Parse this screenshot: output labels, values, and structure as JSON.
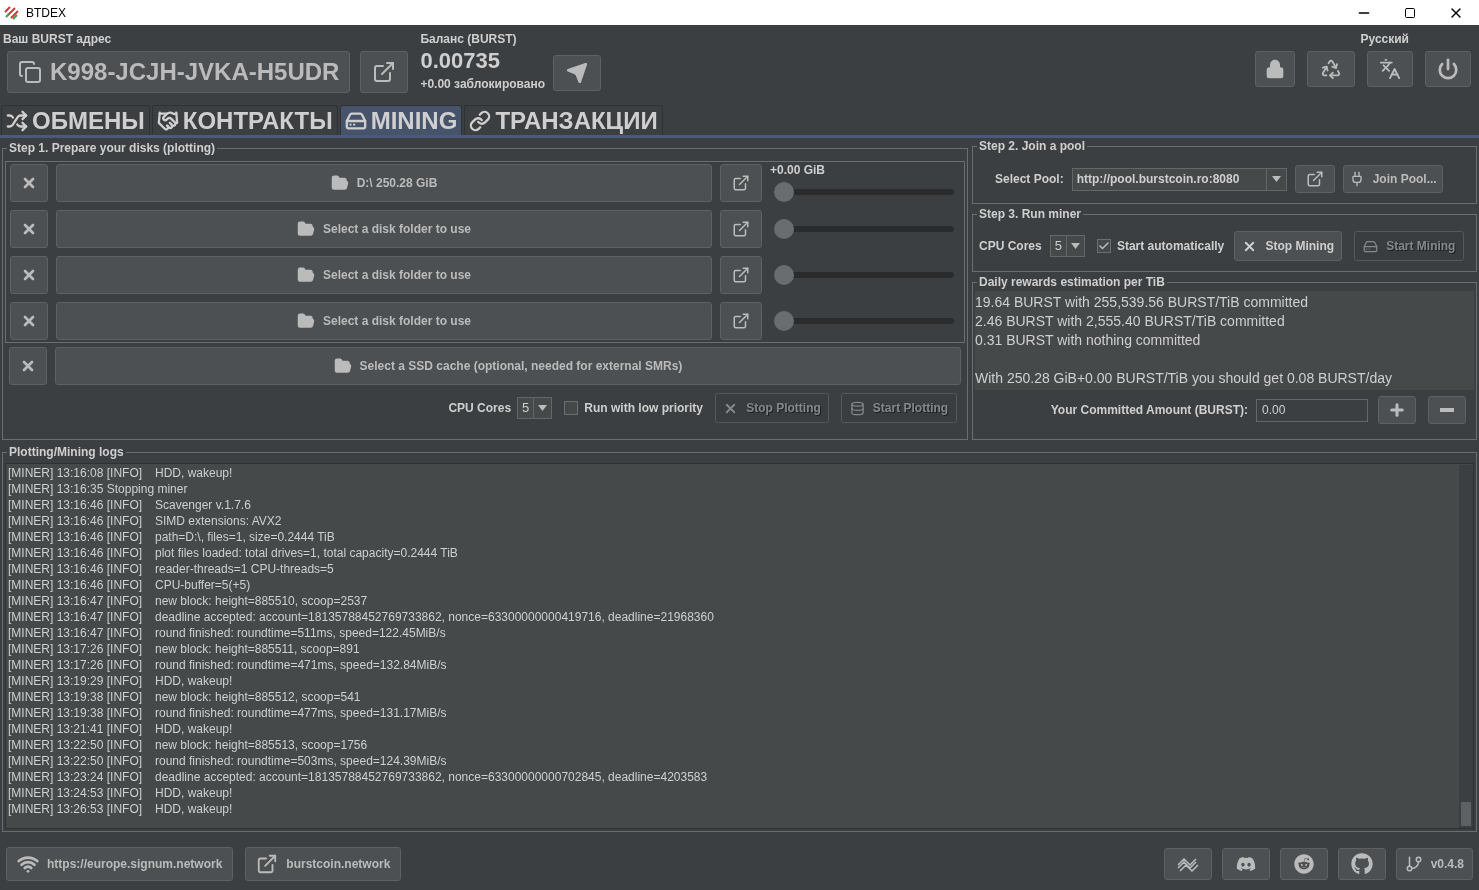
{
  "window": {
    "title": "BTDEX"
  },
  "header": {
    "address_label": "Ваш BURST адрес",
    "address": "K998-JCJH-JVKA-H5UDR",
    "balance_label": "Баланс (BURST)",
    "balance": "0.00735",
    "locked": "+0.00 заблокировано",
    "language": "Русский"
  },
  "tabs": [
    {
      "label": "ОБМЕНЫ",
      "selected": false
    },
    {
      "label": "КОНТРАКТЫ",
      "selected": false
    },
    {
      "label": "MINING",
      "selected": true
    },
    {
      "label": "ТРАНЗАКЦИИ",
      "selected": false
    }
  ],
  "step1": {
    "title": "Step 1. Prepare your disks (plotting)",
    "disks": [
      {
        "label": "D:\\ 250.28 GiB",
        "reading": "+0.00 GiB",
        "level": 0
      },
      {
        "label": "Select a disk folder to use",
        "level": 0
      },
      {
        "label": "Select a disk folder to use",
        "level": 0
      },
      {
        "label": "Select a disk folder to use",
        "level": 0
      }
    ],
    "ssd_cache": "Select a SSD cache (optional, needed for external SMRs)",
    "cpu_label": "CPU Cores",
    "cpu_value": "5",
    "low_priority": {
      "label": "Run with low priority",
      "checked": false
    },
    "buttons": [
      {
        "label": "Stop Plotting",
        "disabled": true
      },
      {
        "label": "Start Plotting",
        "disabled": true
      }
    ]
  },
  "step2": {
    "title": "Step 2. Join a pool",
    "pool_label": "Select Pool:",
    "pool": "http://pool.burstcoin.ro:8080",
    "join": "Join Pool..."
  },
  "step3": {
    "title": "Step 3. Run miner",
    "cpu_label": "CPU Cores",
    "cpu_value": "5",
    "auto_start": {
      "label": "Start automatically",
      "checked": true
    },
    "buttons": [
      {
        "label": "Stop Mining",
        "disabled": false
      },
      {
        "label": "Start Mining",
        "disabled": true
      }
    ]
  },
  "rewards": {
    "title": "Daily rewards estimation per TiB",
    "lines": [
      "19.64 BURST with 255,539.56 BURST/TiB committed",
      "2.46 BURST with 2,555.40 BURST/TiB committed",
      "0.31 BURST with nothing committed",
      "With 250.28 GiB+0.00 BURST/TiB you should get 0.08 BURST/day"
    ],
    "committed_label": "Your Committed Amount (BURST):",
    "committed": "0.00"
  },
  "logs": {
    "title": "Plotting/Mining logs",
    "lines": [
      {
        "kind": "info",
        "head": "[MINER] 13:16:08 [INFO]",
        "text": "HDD, wakeup!"
      },
      {
        "kind": "plain",
        "text": "[MINER] 13:16:35 Stopping miner"
      },
      {
        "kind": "info",
        "head": "[MINER] 13:16:46 [INFO]",
        "text": "Scavenger v.1.7.6"
      },
      {
        "kind": "info",
        "head": "[MINER] 13:16:46 [INFO]",
        "text": "SIMD extensions: AVX2"
      },
      {
        "kind": "info",
        "head": "[MINER] 13:16:46 [INFO]",
        "text": "path=D:\\, files=1, size=0.2444 TiB"
      },
      {
        "kind": "info",
        "head": "[MINER] 13:16:46 [INFO]",
        "text": "plot files loaded: total drives=1, total capacity=0.2444 TiB"
      },
      {
        "kind": "info",
        "head": "[MINER] 13:16:46 [INFO]",
        "text": "reader-threads=1 CPU-threads=5"
      },
      {
        "kind": "info",
        "head": "[MINER] 13:16:46 [INFO]",
        "text": "CPU-buffer=5(+5)"
      },
      {
        "kind": "info",
        "head": "[MINER] 13:16:47 [INFO]",
        "text": "new block: height=885510, scoop=2537"
      },
      {
        "kind": "info",
        "head": "[MINER] 13:16:47 [INFO]",
        "text": "deadline accepted: account=18135788452769733862, nonce=63300000000419716, deadline=21968360"
      },
      {
        "kind": "info",
        "head": "[MINER] 13:16:47 [INFO]",
        "text": "round finished: roundtime=511ms, speed=122.45MiB/s"
      },
      {
        "kind": "info",
        "head": "[MINER] 13:17:26 [INFO]",
        "text": "new block: height=885511, scoop=891"
      },
      {
        "kind": "info",
        "head": "[MINER] 13:17:26 [INFO]",
        "text": "round finished: roundtime=471ms, speed=132.84MiB/s"
      },
      {
        "kind": "info",
        "head": "[MINER] 13:19:29 [INFO]",
        "text": "HDD, wakeup!"
      },
      {
        "kind": "info",
        "head": "[MINER] 13:19:38 [INFO]",
        "text": "new block: height=885512, scoop=541"
      },
      {
        "kind": "info",
        "head": "[MINER] 13:19:38 [INFO]",
        "text": "round finished: roundtime=477ms, speed=131.17MiB/s"
      },
      {
        "kind": "info",
        "head": "[MINER] 13:21:41 [INFO]",
        "text": "HDD, wakeup!"
      },
      {
        "kind": "info",
        "head": "[MINER] 13:22:50 [INFO]",
        "text": "new block: height=885513, scoop=1756"
      },
      {
        "kind": "info",
        "head": "[MINER] 13:22:50 [INFO]",
        "text": "round finished: roundtime=503ms, speed=124.39MiB/s"
      },
      {
        "kind": "info",
        "head": "[MINER] 13:23:24 [INFO]",
        "text": "deadline accepted: account=18135788452769733862, nonce=63300000000702845, deadline=4203583"
      },
      {
        "kind": "info",
        "head": "[MINER] 13:24:53 [INFO]",
        "text": "HDD, wakeup!"
      },
      {
        "kind": "info",
        "head": "[MINER] 13:26:53 [INFO]",
        "text": "HDD, wakeup!"
      }
    ]
  },
  "footer": {
    "node": "https://europe.signum.network",
    "site": "burstcoin.network",
    "version": "v0.4.8"
  }
}
